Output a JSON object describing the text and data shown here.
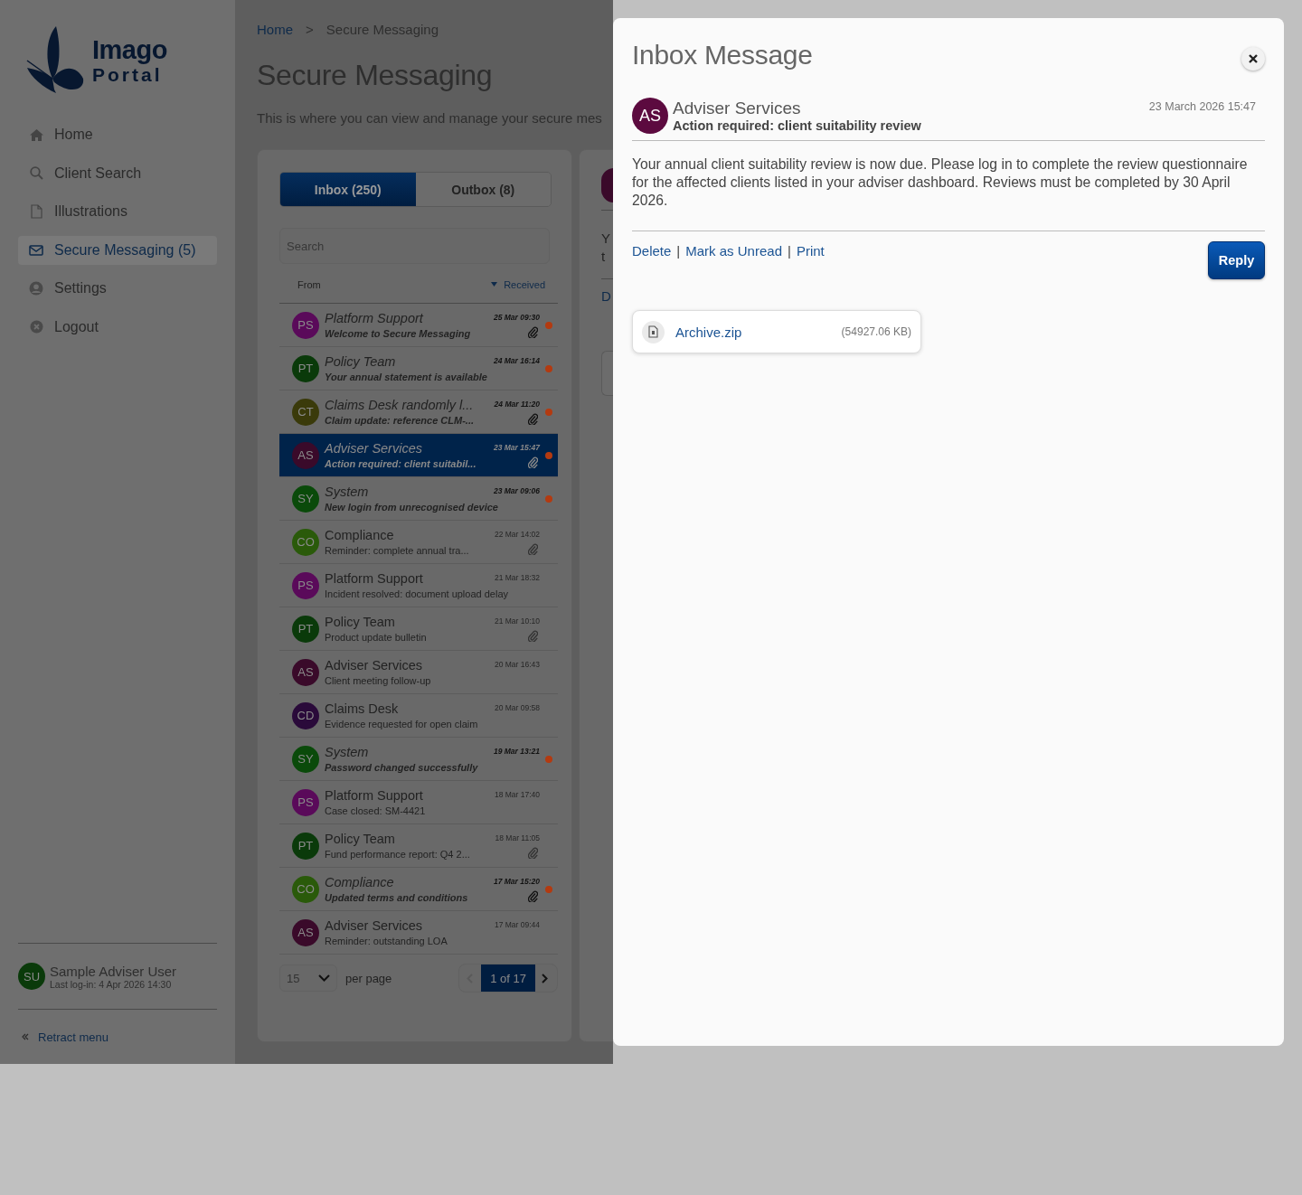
{
  "sidebar": {
    "logo": {
      "name": "Imago",
      "tagline": "Portal"
    },
    "nav": [
      {
        "kind": "home",
        "label": "Home",
        "selected": false
      },
      {
        "kind": "search",
        "label": "Client Search",
        "selected": false
      },
      {
        "kind": "file",
        "label": "Illustrations",
        "selected": false
      },
      {
        "kind": "mail",
        "label": "Secure Messaging (5)",
        "selected": true
      },
      {
        "kind": "user",
        "label": "Settings",
        "selected": false
      },
      {
        "kind": "logout",
        "label": "Logout",
        "selected": false
      }
    ],
    "user": {
      "initials": "SU",
      "color": "#0a3a0a",
      "name": "Sample Adviser User",
      "last_login": "Last log-in: 4 Apr 2026 14:30"
    },
    "retract": "Retract menu"
  },
  "breadcrumb": {
    "items": [
      "Home",
      "Secure Messaging"
    ],
    "separator": ">"
  },
  "page": {
    "title": "Secure Messaging",
    "description": "This is where you can view and manage your secure mes"
  },
  "mailbox": {
    "tabs": [
      {
        "label": "Inbox (250)",
        "selected": true
      },
      {
        "label": "Outbox (8)",
        "selected": false
      }
    ],
    "search": {
      "placeholder": "Search"
    },
    "columns": {
      "from": "From",
      "received": "Received"
    },
    "messages": [
      {
        "initials": "PS",
        "color": "#5a0a5a",
        "from": "Platform Support",
        "subject": "Welcome to Secure Messaging",
        "time": "25 Mar 09:30",
        "attachment": true,
        "unread": true,
        "selected": false
      },
      {
        "initials": "PT",
        "color": "#0a3a0a",
        "from": "Policy Team",
        "subject": "Your annual statement is available",
        "time": "24 Mar 16:14",
        "attachment": false,
        "unread": true,
        "selected": false
      },
      {
        "initials": "CT",
        "color": "#3a3a0a",
        "from": "Claims Desk randomly l...",
        "subject": "Claim update: reference CLM-...",
        "time": "24 Mar 11:20",
        "attachment": true,
        "unread": true,
        "selected": false
      },
      {
        "initials": "AS",
        "color": "#3a0a2a",
        "from": "Adviser Services",
        "subject": "Action required: client suitabil...",
        "time": "23 Mar 15:47",
        "attachment": true,
        "unread": true,
        "selected": true
      },
      {
        "initials": "SY",
        "color": "#0a4a0a",
        "from": "System",
        "subject": "New login from unrecognised device",
        "time": "23 Mar 09:06",
        "attachment": false,
        "unread": true,
        "selected": false
      },
      {
        "initials": "CO",
        "color": "#2a5a0a",
        "from": "Compliance",
        "subject": "Reminder: complete annual tra...",
        "time": "22 Mar 14:02",
        "attachment": true,
        "unread": false,
        "selected": false
      },
      {
        "initials": "PS",
        "color": "#5a0a5a",
        "from": "Platform Support",
        "subject": "Incident resolved: document upload delay",
        "time": "21 Mar 18:32",
        "attachment": false,
        "unread": false,
        "selected": false
      },
      {
        "initials": "PT",
        "color": "#0a3a0a",
        "from": "Policy Team",
        "subject": "Product update bulletin",
        "time": "21 Mar 10:10",
        "attachment": true,
        "unread": false,
        "selected": false
      },
      {
        "initials": "AS",
        "color": "#3a0a2a",
        "from": "Adviser Services",
        "subject": "Client meeting follow-up",
        "time": "20 Mar 16:43",
        "attachment": false,
        "unread": false,
        "selected": false
      },
      {
        "initials": "CD",
        "color": "#2a0a3a",
        "from": "Claims Desk",
        "subject": "Evidence requested for open claim",
        "time": "20 Mar 09:58",
        "attachment": false,
        "unread": false,
        "selected": false
      },
      {
        "initials": "SY",
        "color": "#0a4a0a",
        "from": "System",
        "subject": "Password changed successfully",
        "time": "19 Mar 13:21",
        "attachment": false,
        "unread": true,
        "selected": false
      },
      {
        "initials": "PS",
        "color": "#5a0a5a",
        "from": "Platform Support",
        "subject": "Case closed: SM-4421",
        "time": "18 Mar 17:40",
        "attachment": false,
        "unread": false,
        "selected": false
      },
      {
        "initials": "PT",
        "color": "#0a3a0a",
        "from": "Policy Team",
        "subject": "Fund performance report: Q4 2...",
        "time": "18 Mar 11:05",
        "attachment": true,
        "unread": false,
        "selected": false
      },
      {
        "initials": "CO",
        "color": "#2a5a0a",
        "from": "Compliance",
        "subject": "Updated terms and conditions",
        "time": "17 Mar 15:20",
        "attachment": true,
        "unread": true,
        "selected": false
      },
      {
        "initials": "AS",
        "color": "#3a0a2a",
        "from": "Adviser Services",
        "subject": "Reminder: outstanding LOA",
        "time": "17 Mar 09:44",
        "attachment": false,
        "unread": false,
        "selected": false
      }
    ],
    "pagination": {
      "per_page": "15",
      "per_page_label": "per page",
      "page": "1 of 17"
    }
  },
  "preview": {
    "lines": [
      "Y",
      "t"
    ],
    "link": "D"
  },
  "modal": {
    "title": "Inbox Message",
    "initials": "AS",
    "color": "#5c0a3f",
    "sender": "Adviser Services",
    "subject": "Action required: client suitability review",
    "date": "23 March 2026 15:47",
    "body": "Your annual client suitability review is now due. Please log in to complete the review questionnaire for the affected clients listed in your adviser dashboard. Reviews must be completed by 30 April 2026.",
    "actions": [
      "Delete",
      "Mark as Unread",
      "Print"
    ],
    "separator": "|",
    "reply": "Reply",
    "attachment": {
      "name": "Archive.zip",
      "size": "(54927.06 KB)"
    }
  }
}
